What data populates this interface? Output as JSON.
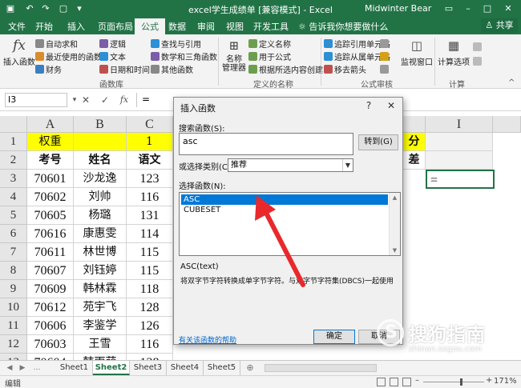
{
  "window": {
    "title": "excel学生成绩单 [兼容模式] - Excel",
    "user": "Midwinter Bear",
    "icons": [
      "save-icon",
      "undo-icon",
      "redo-icon",
      "new-file-icon",
      "customize-dropdown-icon",
      "ribbon-display-icon",
      "minimize-icon",
      "maximize-icon",
      "close-icon"
    ]
  },
  "tabs": [
    "文件",
    "开始",
    "插入",
    "页面布局",
    "公式",
    "数据",
    "审阅",
    "视图",
    "开发工具"
  ],
  "active_tab": "公式",
  "tell_me": "告诉我你想要做什么",
  "share": "共享",
  "ribbon": {
    "insert_function": "插入函数",
    "autosum": "自动求和",
    "recent": "最近使用的函数",
    "financial": "财务",
    "logical": "逻辑",
    "text": "文本",
    "datetime": "日期和时间",
    "lookup": "查找与引用",
    "math": "数学和三角函数",
    "more": "其他函数",
    "group_library": "函数库",
    "name_manager": "名称\n管理器",
    "name_manager_line1": "名称",
    "name_manager_line2": "管理器",
    "define_name": "定义名称",
    "use_in_formula": "用于公式",
    "create_from_selection": "根据所选内容创建",
    "group_names": "定义的名称",
    "trace_precedents": "追踪引用单元格",
    "trace_dependents": "追踪从属单元格",
    "remove_arrows": "移去箭头",
    "group_audit": "公式审核",
    "watch_window": "监视窗口",
    "calc_options": "计算选项",
    "group_calc": "计算"
  },
  "formula_bar": {
    "name_box": "I3",
    "value": "="
  },
  "grid": {
    "columns": [
      "A",
      "B",
      "C"
    ],
    "rows": [
      "1",
      "2",
      "3",
      "4",
      "5",
      "6",
      "7",
      "8",
      "9",
      "10",
      "11",
      "12",
      "13"
    ],
    "row1": [
      "权重",
      "",
      "1"
    ],
    "row2": [
      "考号",
      "姓名",
      "语文"
    ],
    "data": [
      [
        "70601",
        "沙龙逸",
        "123"
      ],
      [
        "70602",
        "刘帅",
        "116"
      ],
      [
        "70605",
        "杨璐",
        "131"
      ],
      [
        "70616",
        "康惠雯",
        "114"
      ],
      [
        "70611",
        "林世博",
        "115"
      ],
      [
        "70607",
        "刘钰婷",
        "115"
      ],
      [
        "70609",
        "韩林霖",
        "118"
      ],
      [
        "70612",
        "苑宇飞",
        "128"
      ],
      [
        "70606",
        "李鉴学",
        "126"
      ],
      [
        "70603",
        "王雪",
        "116"
      ],
      [
        "70604",
        "韩雨萌",
        "128"
      ]
    ],
    "right_col_header": "I",
    "right_hdr_1": "分",
    "right_hdr_2": "差",
    "selected_cell_value": "="
  },
  "sheets": [
    "Sheet1",
    "Sheet2",
    "Sheet3",
    "Sheet4",
    "Sheet5"
  ],
  "active_sheet": "Sheet2",
  "status": {
    "mode": "编辑",
    "zoom": "171%"
  },
  "dialog": {
    "title": "插入函数",
    "help_btn": "?",
    "close_btn": "✕",
    "search_label": "搜索函数(S):",
    "search_value": "asc",
    "goto_btn": "转到(G)",
    "category_label": "或选择类别(C):",
    "category_value": "推荐",
    "select_label": "选择函数(N):",
    "functions": [
      "ASC",
      "CUBESET"
    ],
    "selected_function": "ASC",
    "syntax": "ASC(text)",
    "description": "将双字节字符转换成单字节字符。与双字节字符集(DBCS)一起使用",
    "help_link": "有关该函数的帮助",
    "ok": "确定",
    "cancel": "取消"
  },
  "watermark": {
    "logo_char": "S",
    "text": "搜狗指南",
    "url": "zhinan.sogou.com"
  },
  "colors": {
    "excel_green": "#217346",
    "yellow_fill": "#ffff00",
    "selection_blue": "#0078d7",
    "arrow_red": "#e8292c"
  }
}
